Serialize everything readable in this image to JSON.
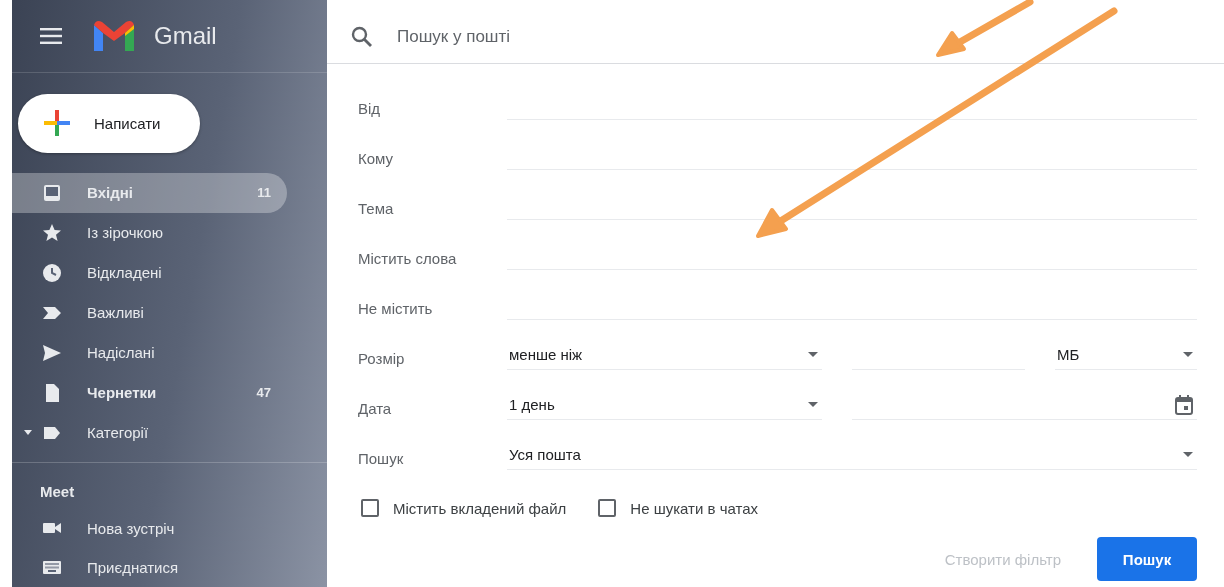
{
  "app": {
    "name": "Gmail"
  },
  "compose": {
    "label": "Написати"
  },
  "sidebar": {
    "items": [
      {
        "label": "Вхідні",
        "count": "11",
        "selected": true,
        "unread": true
      },
      {
        "label": "Із зірочкою",
        "selected": false,
        "unread": false
      },
      {
        "label": "Відкладені",
        "selected": false,
        "unread": false
      },
      {
        "label": "Важливі",
        "selected": false,
        "unread": false
      },
      {
        "label": "Надіслані",
        "selected": false,
        "unread": false
      },
      {
        "label": "Чернетки",
        "count": "47",
        "selected": false,
        "unread": true
      },
      {
        "label": "Категорії",
        "selected": false,
        "unread": false
      }
    ],
    "meet": {
      "title": "Meet",
      "items": [
        {
          "label": "Нова зустріч"
        },
        {
          "label": "Приєднатися"
        }
      ]
    }
  },
  "search": {
    "placeholder": "Пошук у пошті"
  },
  "form": {
    "rows": [
      {
        "kind": "text",
        "label": "Від"
      },
      {
        "kind": "text",
        "label": "Кому"
      },
      {
        "kind": "text",
        "label": "Тема"
      },
      {
        "kind": "text",
        "label": "Містить слова"
      },
      {
        "kind": "text",
        "label": "Не містить"
      },
      {
        "kind": "size",
        "label": "Розмір",
        "operator": "менше ніж",
        "unit": "МБ"
      },
      {
        "kind": "date",
        "label": "Дата",
        "range": "1 день"
      },
      {
        "kind": "select",
        "label": "Пошук",
        "value": "Уся пошта"
      }
    ],
    "checkboxes": [
      {
        "label": "Містить вкладений файл",
        "checked": false
      },
      {
        "label": "Не шукати в чатах",
        "checked": false
      }
    ],
    "buttons": [
      {
        "label": "Створити фільтр",
        "kind": "text",
        "disabled": true
      },
      {
        "label": "Пошук",
        "kind": "primary",
        "disabled": false
      }
    ]
  }
}
